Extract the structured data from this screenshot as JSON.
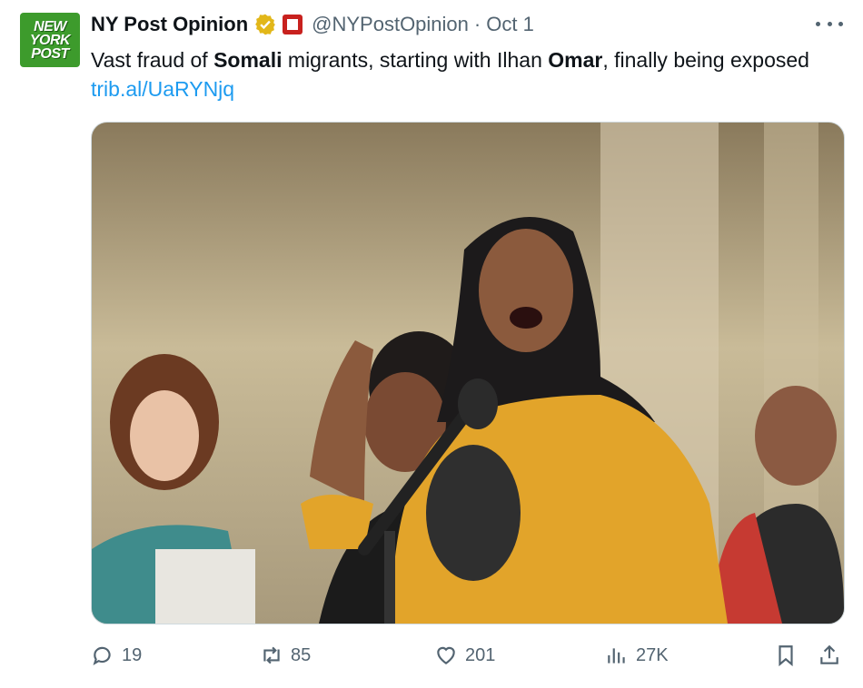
{
  "account": {
    "logo_lines": [
      "NEW",
      "YORK",
      "POST"
    ],
    "name": "NY Post Opinion",
    "handle": "@NYPostOpinion",
    "separator": "·",
    "date": "Oct 1"
  },
  "tweet": {
    "parts": {
      "p1": "Vast fraud of ",
      "p2": "Somali",
      "p3": " migrants, starting with Ilhan ",
      "p4": "Omar",
      "p5": ", finally being exposed ",
      "link": "trib.al/UaRYNjq"
    }
  },
  "actions": {
    "replies": "19",
    "reposts": "85",
    "likes": "201",
    "views": "27K"
  },
  "colors": {
    "verified_gold": "#e2b719",
    "logo_green": "#3d9b2c",
    "link_blue": "#1d9bf0",
    "muted": "#536471"
  }
}
